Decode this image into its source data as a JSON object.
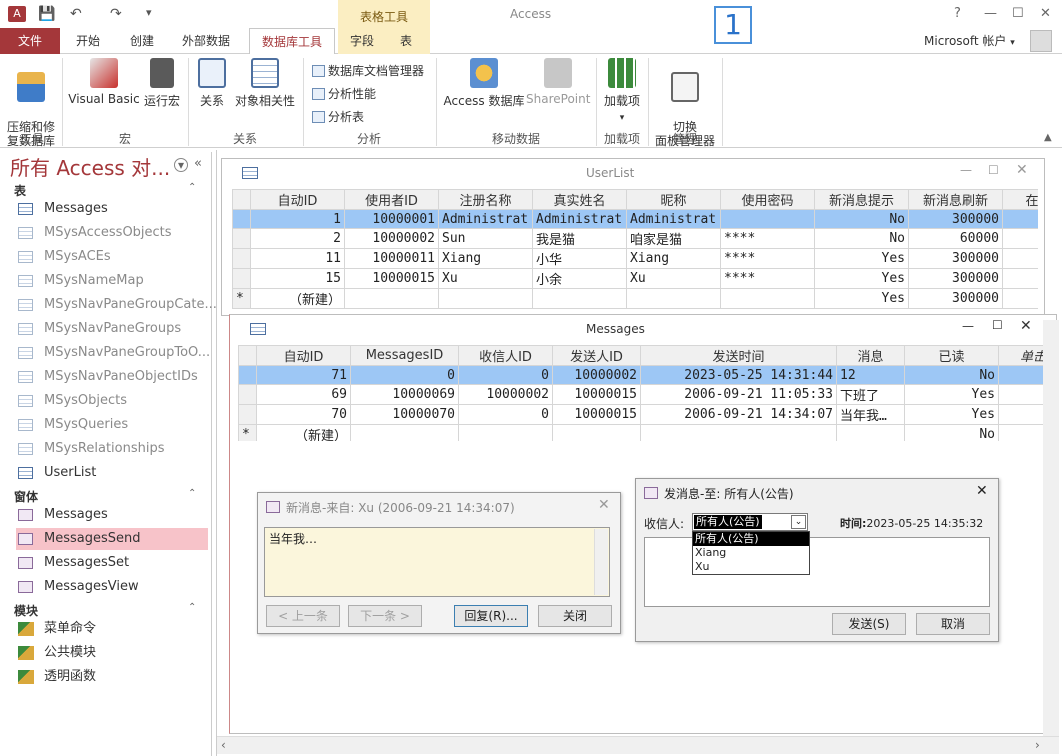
{
  "window": {
    "app_title": "Access",
    "context_group": "表格工具",
    "badge": "1",
    "help": "?",
    "account": "Microsoft 帐户",
    "account_caret": "▾"
  },
  "quick_access": {
    "save": "💾",
    "undo": "↶",
    "redo": "↷",
    "more": "▾"
  },
  "tabs": [
    "文件",
    "开始",
    "创建",
    "外部数据",
    "数据库工具",
    "字段",
    "表"
  ],
  "ribbon": {
    "compact": "压缩和修\n复数据库",
    "visual_basic": "Visual Basic",
    "run_macro": "运行宏",
    "relations": "关系",
    "obj_deps": "对象相关性",
    "doc_manager": "数据库文档管理器",
    "analyze_perf": "分析性能",
    "analyze_table": "分析表",
    "access_db": "Access 数据库",
    "sharepoint": "SharePoint",
    "addins": "加载项",
    "switch_panel": "切换\n面板管理器",
    "groups": {
      "tools": "工具",
      "macro": "宏",
      "relations": "关系",
      "analyze": "分析",
      "move": "移动数据",
      "addins": "加载项",
      "manage": "管理"
    }
  },
  "nav": {
    "title": "所有 Access 对...",
    "sections": {
      "tables": "表",
      "forms": "窗体",
      "modules": "模块"
    },
    "tables": [
      "Messages",
      "MSysAccessObjects",
      "MSysACEs",
      "MSysNameMap",
      "MSysNavPaneGroupCate...",
      "MSysNavPaneGroups",
      "MSysNavPaneGroupToO...",
      "MSysNavPaneObjectIDs",
      "MSysObjects",
      "MSysQueries",
      "MSysRelationships",
      "UserList"
    ],
    "forms": [
      "Messages",
      "MessagesSend",
      "MessagesSet",
      "MessagesView"
    ],
    "modules": [
      "菜单命令",
      "公共模块",
      "透明函数"
    ]
  },
  "userlist": {
    "title": "UserList",
    "columns": [
      "自动ID",
      "使用者ID",
      "注册名称",
      "真实姓名",
      "昵称",
      "使用密码",
      "新消息提示",
      "新消息刷新",
      "在"
    ],
    "rows": [
      [
        "1",
        "10000001",
        "Administrat",
        "Administrat",
        "Administrat",
        "",
        "No",
        "300000",
        ""
      ],
      [
        "2",
        "10000002",
        "Sun",
        "我是猫",
        "咱家是猫",
        "****",
        "No",
        "60000",
        ""
      ],
      [
        "11",
        "10000011",
        "Xiang",
        "小华",
        "Xiang",
        "****",
        "Yes",
        "300000",
        ""
      ],
      [
        "15",
        "10000015",
        "Xu",
        "小余",
        "Xu",
        "****",
        "Yes",
        "300000",
        ""
      ]
    ],
    "new_row": [
      "（新建）",
      "",
      "",
      "",
      "",
      "",
      "Yes",
      "300000",
      ""
    ]
  },
  "messages": {
    "title": "Messages",
    "columns": [
      "自动ID",
      "MessagesID",
      "收信人ID",
      "发送人ID",
      "发送时间",
      "消息",
      "已读",
      "单击"
    ],
    "rows": [
      [
        "71",
        "0",
        "0",
        "10000002",
        "2023-05-25 14:31:44",
        "12",
        "No",
        ""
      ],
      [
        "69",
        "10000069",
        "10000002",
        "10000015",
        "2006-09-21 11:05:33",
        "下班了",
        "Yes",
        ""
      ],
      [
        "70",
        "10000070",
        "0",
        "10000015",
        "2006-09-21 14:34:07",
        "当年我…",
        "Yes",
        ""
      ]
    ],
    "new_row": [
      "（新建）",
      "",
      "",
      "",
      "",
      "",
      "No",
      ""
    ]
  },
  "dialog_new": {
    "title": "新消息-来自: Xu (2006-09-21 14:34:07)",
    "body": "当年我…",
    "prev": "< 上一条",
    "next": "下一条 >",
    "reply": "回复(R)...",
    "close": "关闭"
  },
  "dialog_send": {
    "title": "发消息-至: 所有人(公告)",
    "recipient_label": "收信人:",
    "recipient_value": "所有人(公告)",
    "time_label": "时间:",
    "time_value": "2023-05-25 14:35:32",
    "options": [
      "所有人(公告)",
      "Xiang",
      "Xu"
    ],
    "send": "发送(S)",
    "cancel": "取消"
  }
}
